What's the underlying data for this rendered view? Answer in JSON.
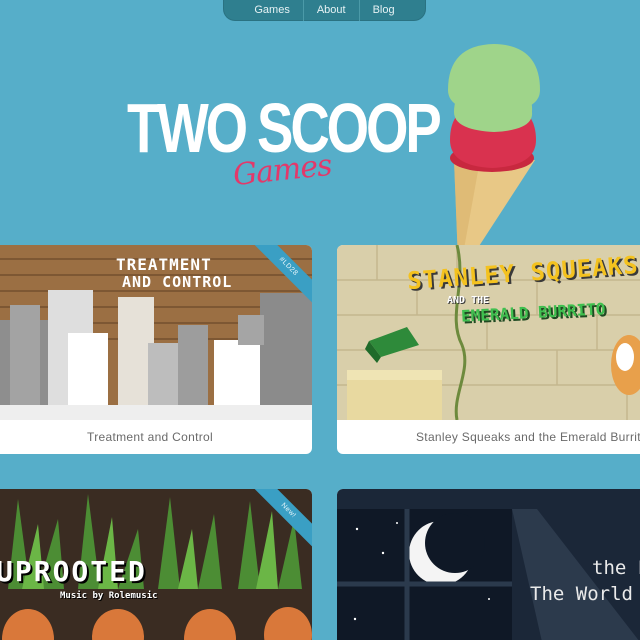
{
  "nav": {
    "items": [
      {
        "label": "Games"
      },
      {
        "label": "About"
      },
      {
        "label": "Blog"
      }
    ]
  },
  "logo": {
    "main": "TWO SCOOP",
    "sub": "Games"
  },
  "colors": {
    "background": "#56aec9",
    "nav": "#2f7f8f",
    "accent_pink": "#e3386a",
    "scoop_green": "#9fd48a",
    "scoop_pink": "#d9324f",
    "cone": "#e8c886",
    "ribbon": "#3a9fc4"
  },
  "games": [
    {
      "title": "Treatment and Control",
      "art_title_1": "TREATMENT",
      "art_title_2": "AND CONTROL",
      "badge": "#LD28"
    },
    {
      "title": "Stanley Squeaks and the Emerald Burrito",
      "art_title_1": "STANLEY SQUEAKS",
      "art_title_2": "AND THE",
      "art_title_3": "EMERALD BURRITO"
    },
    {
      "title": "",
      "art_title_1": "UPROOTED",
      "art_subtitle": "Music by Rolemusic",
      "badge": "New!"
    },
    {
      "title": "",
      "art_title_1": "the L",
      "art_title_2": "The World"
    }
  ]
}
